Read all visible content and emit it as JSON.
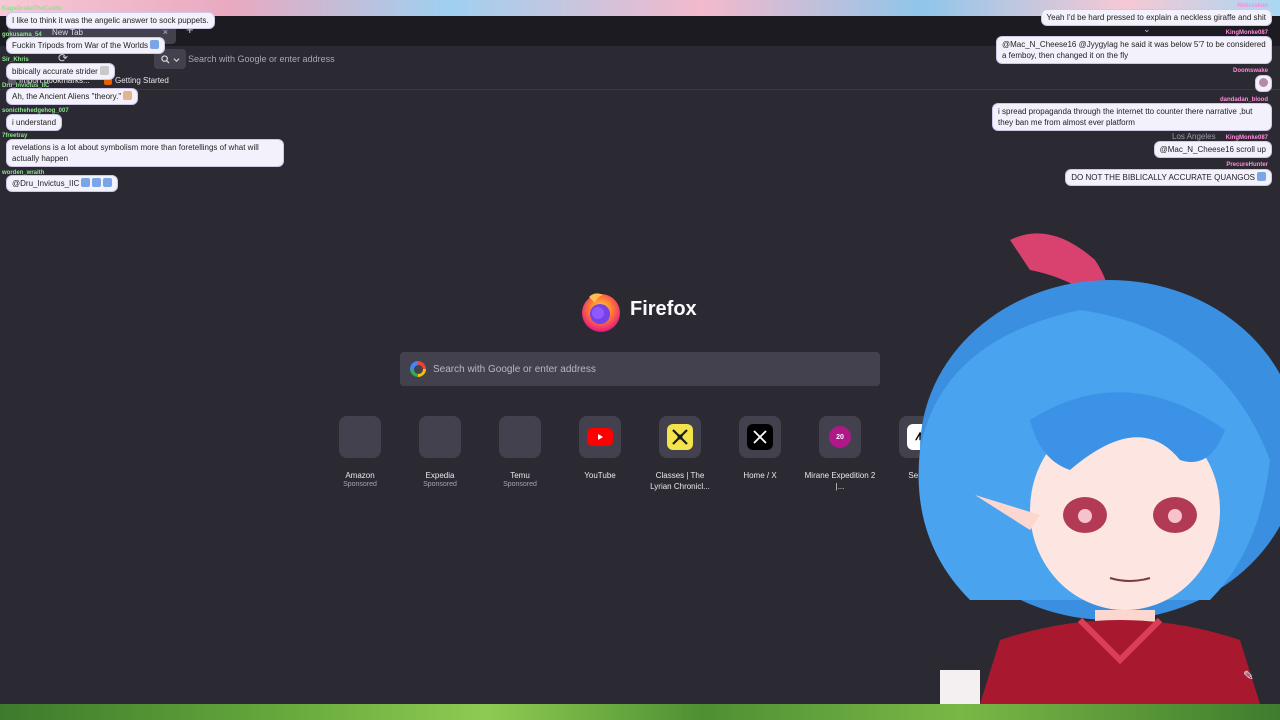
{
  "browser": {
    "tab_title": "New Tab",
    "tab_close": "×",
    "new_tab": "+",
    "tab_list": "⌄",
    "reload": "⟳",
    "url_placeholder": "Search with Google or enter address",
    "bookmarks": [
      "Import bookmarks...",
      "Getting Started"
    ]
  },
  "newtab": {
    "brand": "Firefox",
    "search_placeholder": "Search with Google or enter address",
    "shortcuts": [
      {
        "title": "Amazon",
        "sub": "Sponsored",
        "icon": "amazon-icon"
      },
      {
        "title": "Expedia",
        "sub": "Sponsored",
        "icon": "expedia-icon"
      },
      {
        "title": "Temu",
        "sub": "Sponsored",
        "icon": "temu-icon"
      },
      {
        "title": "YouTube",
        "sub": "",
        "icon": "youtube-icon"
      },
      {
        "title": "Classes | The Lyrian Chronicl...",
        "sub": "",
        "icon": "swords-icon"
      },
      {
        "title": "Home / X",
        "sub": "",
        "icon": "x-icon"
      },
      {
        "title": "Mirane Expedition 2 |...",
        "sub": "",
        "icon": "mirane-icon",
        "badge": "20"
      },
      {
        "title": "Se Ani",
        "sub": "",
        "icon": "anime-icon"
      }
    ]
  },
  "overlay": {
    "weather_location": "Los Angeles",
    "edit_icon": "✎"
  },
  "chat_left": [
    {
      "user": "KageDrakeTheCastle",
      "text": "I like to think it was the angelic answer to sock puppets."
    },
    {
      "user": "gokusama_54",
      "text": "Fuckin Tripods from War of the Worlds"
    },
    {
      "user": "Sir_Khris",
      "text": "bibically accurate strider"
    },
    {
      "user": "Dru_Invictus_IIC",
      "text": "Ah, the Ancient Aliens \"theory.\""
    },
    {
      "user": "sonicthehedgehog_007",
      "text": "i understand"
    },
    {
      "user": "7freetray",
      "text": "revelations is a lot about symbolism more than foretellings of what will actually happen"
    },
    {
      "user": "worden_wraith",
      "text": "@Dru_Invictus_IIC"
    }
  ],
  "chat_right": [
    {
      "user": "Nebraskan",
      "text": "Yeah I'd be hard pressed to explain a neckless giraffe and shit"
    },
    {
      "user": "KingMonke087",
      "text": "@Mac_N_Cheese16 @Jyygylag he said it was below 5'7 to be considered a femboy, then changed it on the fly"
    },
    {
      "user": "Doomswake",
      "text": ""
    },
    {
      "user": "dandadan_blood",
      "text": "i spread propaganda through the internet tto counter there narrative ,but they ban me from almost ever platform"
    },
    {
      "user": "KingMonke087",
      "text": "@Mac_N_Cheese16 scroll up"
    },
    {
      "user": "PrecureHunter",
      "text": "DO NOT THE BIBLICALLY ACCURATE QUANGOS"
    }
  ],
  "colors": {
    "page_bg": "#2b2a33",
    "tile_bg": "#42414d",
    "text": "#fbfbfe",
    "muted": "#a4a4ae"
  }
}
